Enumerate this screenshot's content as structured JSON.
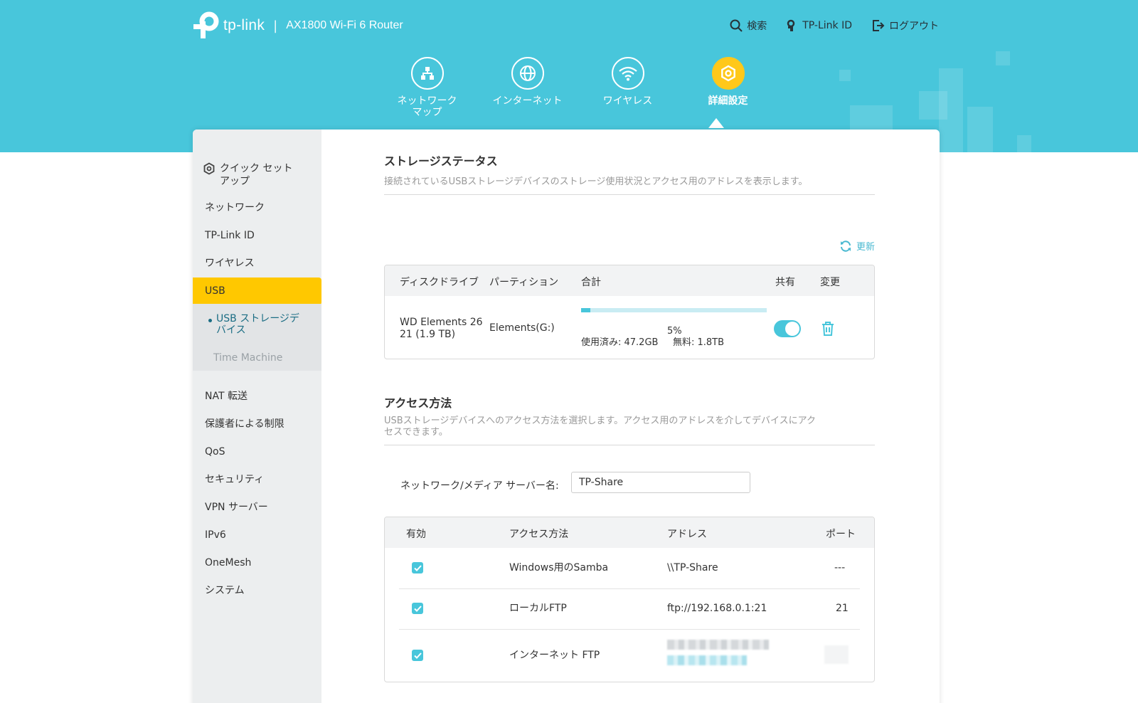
{
  "brand": {
    "name": "tp-link",
    "separator": "|",
    "model": "AX1800 Wi-Fi 6 Router"
  },
  "top_actions": {
    "search": "検索",
    "tplink_id": "TP-Link ID",
    "logout": "ログアウト"
  },
  "main_nav": [
    {
      "label": "ネットワーク\nマップ",
      "icon": "network-map-icon"
    },
    {
      "label": "インターネット",
      "icon": "globe-icon"
    },
    {
      "label": "ワイヤレス",
      "icon": "wifi-icon"
    },
    {
      "label": "詳細設定",
      "icon": "gear-icon",
      "active": true
    }
  ],
  "sidebar": {
    "items": [
      {
        "label": "クイック セット\nアップ",
        "icon": "gear-icon"
      },
      {
        "label": "ネットワーク"
      },
      {
        "label": "TP-Link ID"
      },
      {
        "label": "ワイヤレス"
      },
      {
        "label": "USB",
        "active": true
      },
      {
        "label": "NAT 転送"
      },
      {
        "label": "保護者による制限"
      },
      {
        "label": "QoS"
      },
      {
        "label": "セキュリティ"
      },
      {
        "label": "VPN サーバー"
      },
      {
        "label": "IPv6"
      },
      {
        "label": "OneMesh"
      },
      {
        "label": "システム"
      }
    ],
    "submenu": [
      {
        "label": "USB ストレージデ\nバイス",
        "selected": true
      },
      {
        "label": "Time Machine"
      }
    ]
  },
  "storage": {
    "title": "ストレージステータス",
    "description": "接続されているUSBストレージデバイスのストレージ使用状況とアクセス用のアドレスを表示します。",
    "refresh_label": "更新",
    "columns": [
      "ディスクドライブ",
      "パーティション",
      "合計",
      "共有",
      "変更"
    ],
    "row": {
      "disk": "WD   Elements 26\n21 (1.9 TB)",
      "partition": "Elements(G:)",
      "usage_percent_label": "5%",
      "usage_fraction": 0.05,
      "used": "使用済み: 47.2GB",
      "free": "無料: 1.8TB",
      "shared": true
    }
  },
  "access": {
    "title": "アクセス方法",
    "description": "USBストレージデバイスへのアクセス方法を選択します。アクセス用のアドレスを介してデバイスにアク\nセスできます。",
    "server_name_label": "ネットワーク/メディア サーバー名:",
    "server_name_value": "TP-Share",
    "columns": [
      "有効",
      "アクセス方法",
      "アドレス",
      "ポート"
    ],
    "rows": [
      {
        "enabled": true,
        "method": "Windows用のSamba",
        "address": "\\\\TP-Share",
        "port": "---"
      },
      {
        "enabled": true,
        "method": "ローカルFTP",
        "address": "ftp://192.168.0.1:21",
        "port": "21"
      },
      {
        "enabled": true,
        "method": "インターネット FTP",
        "address": "",
        "port": ""
      }
    ]
  },
  "colors": {
    "header": "#48c6db",
    "accent_yellow": "#ffc800",
    "accent_teal": "#48c6db"
  }
}
